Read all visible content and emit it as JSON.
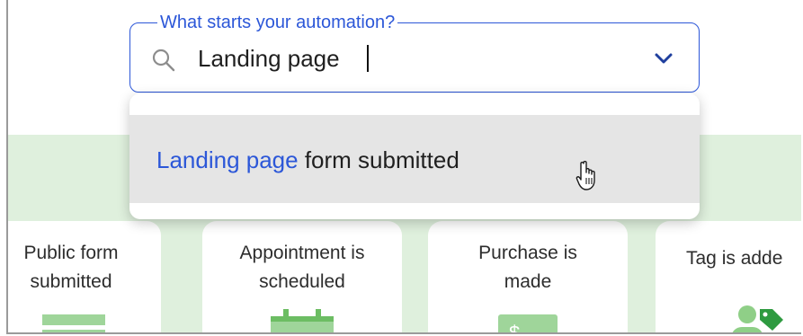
{
  "combobox": {
    "legend": "What starts your automation?",
    "value": "Landing page",
    "search_icon": "search-icon",
    "dropdown_icon": "chevron-down-icon"
  },
  "dropdown": {
    "options": [
      {
        "highlight": "Landing page",
        "rest": " form submitted"
      }
    ]
  },
  "cards": [
    {
      "label": "Public form\nsubmitted",
      "icon": "form-icon"
    },
    {
      "label": "Appointment is\nscheduled",
      "icon": "calendar-icon"
    },
    {
      "label": "Purchase is\nmade",
      "icon": "dollar-icon"
    },
    {
      "label": "Tag is adde",
      "icon": "person-tag-icon"
    }
  ],
  "colors": {
    "accent": "#2c57d8",
    "green_bg": "#dff0dd",
    "icon_green": "#8fcf87",
    "option_hover": "#e5e5e5"
  }
}
